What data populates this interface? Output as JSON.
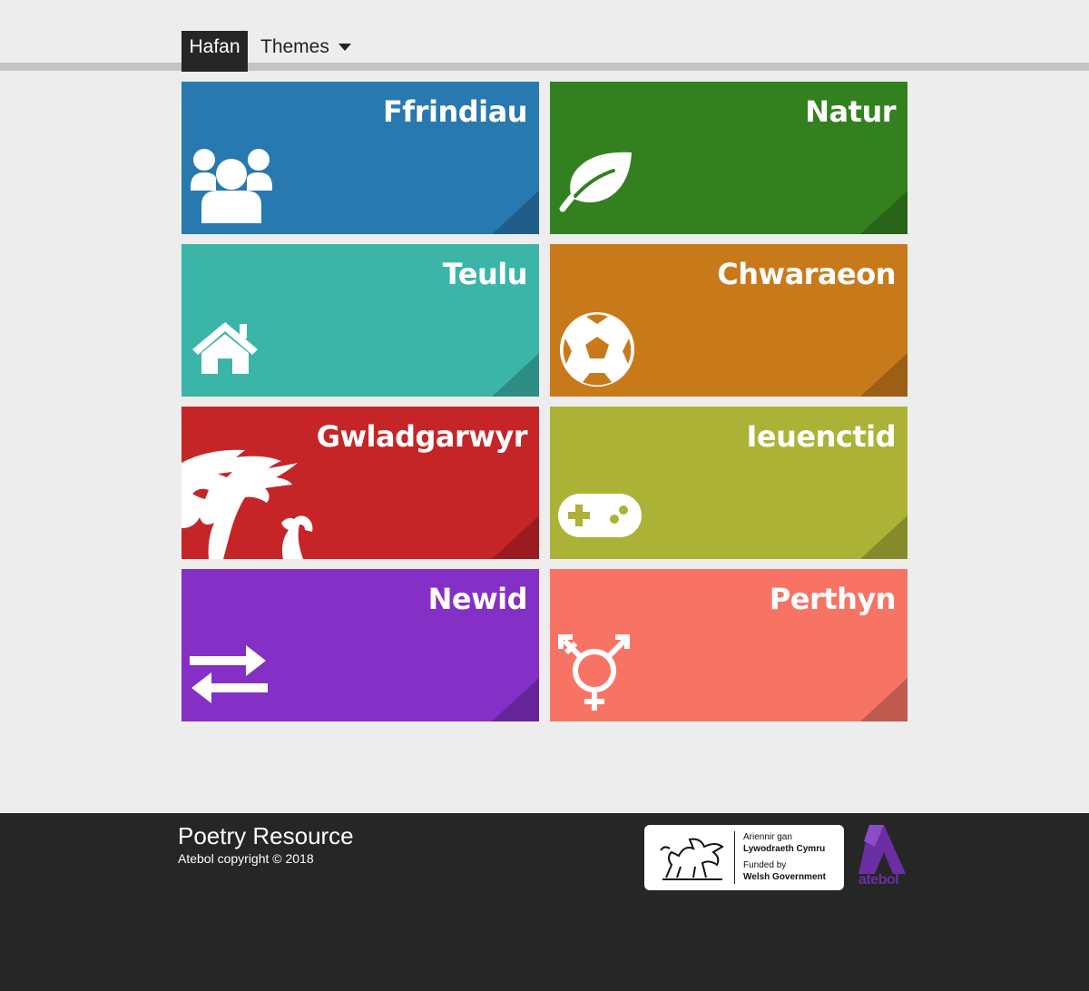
{
  "nav": {
    "home_label": "Hafan",
    "themes_label": "Themes"
  },
  "tiles": [
    {
      "title": "Ffrindiau",
      "color": "#2779b0",
      "icon": "users-icon"
    },
    {
      "title": "Natur",
      "color": "#33801f",
      "icon": "leaf-icon"
    },
    {
      "title": "Teulu",
      "color": "#3bb5a7",
      "icon": "home-icon"
    },
    {
      "title": "Chwaraeon",
      "color": "#c87a1b",
      "icon": "soccer-ball-icon"
    },
    {
      "title": "Gwladgarwyr",
      "color": "#c62528",
      "icon": "welsh-dragon-icon"
    },
    {
      "title": "Ieuenctid",
      "color": "#abb236",
      "icon": "gamepad-icon"
    },
    {
      "title": "Newid",
      "color": "#842fc6",
      "icon": "exchange-arrows-icon"
    },
    {
      "title": "Perthyn",
      "color": "#f77465",
      "icon": "transgender-symbol-icon"
    }
  ],
  "footer": {
    "title": "Poetry Resource",
    "copyright": "Atebol copyright © 2018",
    "welsh_gov": {
      "line1": "Ariennir gan",
      "line2": "Lywodraeth Cymru",
      "line3": "Funded by",
      "line4": "Welsh Government"
    },
    "atebol_logo_text": "atebol",
    "atebol_color": "#6b2fa3"
  }
}
